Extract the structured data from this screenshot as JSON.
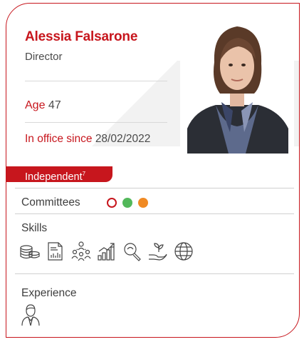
{
  "director": {
    "name": "Alessia Falsarone",
    "role": "Director",
    "age_label": "Age",
    "age_value": "47",
    "office_label": "In office since",
    "office_value": "28/02/2022",
    "badge_label": "Independent",
    "badge_note": "7"
  },
  "committees": {
    "label": "Committees",
    "dots": [
      {
        "style": "outline",
        "color": "#c7161d"
      },
      {
        "style": "filled",
        "color": "#52b85a"
      },
      {
        "style": "filled",
        "color": "#f08a24"
      }
    ]
  },
  "skills": {
    "label": "Skills",
    "icons": [
      "coins-stack-icon",
      "report-chart-icon",
      "team-network-icon",
      "growth-chart-icon",
      "magnifier-icon",
      "hand-plant-icon",
      "globe-icon"
    ]
  },
  "experience": {
    "label": "Experience",
    "icons": [
      "person-icon"
    ]
  },
  "colors": {
    "accent": "#c7161d",
    "text": "#4a4a4a",
    "divider": "#d9d9d9"
  }
}
